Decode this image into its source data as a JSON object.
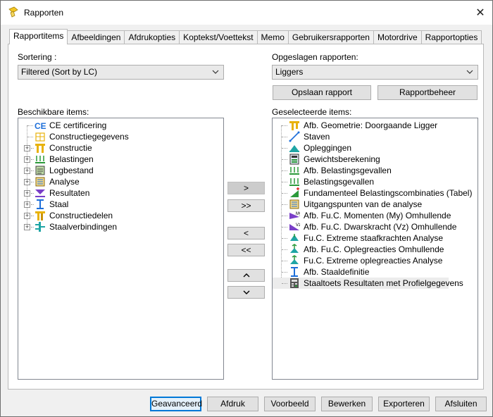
{
  "window": {
    "title": "Rapporten",
    "close_glyph": "✕"
  },
  "tabs": [
    {
      "label": "Rapportitems",
      "active": true
    },
    {
      "label": "Afbeeldingen"
    },
    {
      "label": "Afdrukopties"
    },
    {
      "label": "Koptekst/Voettekst"
    },
    {
      "label": "Memo"
    },
    {
      "label": "Gebruikersrapporten"
    },
    {
      "label": "Motordrive"
    },
    {
      "label": "Rapportopties"
    }
  ],
  "sort": {
    "label": "Sortering :",
    "value": "Filtered (Sort by LC)"
  },
  "saved": {
    "label": "Opgeslagen rapporten:",
    "value": "Liggers",
    "save_button": "Opslaan rapport",
    "manage_button": "Rapportbeheer"
  },
  "available": {
    "label": "Beschikbare items:",
    "items": [
      {
        "label": "CE certificering",
        "icon": "ce-icon",
        "expandable": false
      },
      {
        "label": "Constructiegegevens",
        "icon": "structure-data-icon",
        "expandable": false
      },
      {
        "label": "Constructie",
        "icon": "construction-icon",
        "expandable": true
      },
      {
        "label": "Belastingen",
        "icon": "loads-icon",
        "expandable": true
      },
      {
        "label": "Logbestand",
        "icon": "logfile-icon",
        "expandable": true
      },
      {
        "label": "Analyse",
        "icon": "analysis-icon",
        "expandable": true
      },
      {
        "label": "Resultaten",
        "icon": "results-icon",
        "expandable": true
      },
      {
        "label": "Staal",
        "icon": "steel-icon",
        "expandable": true
      },
      {
        "label": "Constructiedelen",
        "icon": "members-icon",
        "expandable": true
      },
      {
        "label": "Staalverbindingen",
        "icon": "steel-connection-icon",
        "expandable": true
      }
    ]
  },
  "selected": {
    "label": "Geselecteerde items:",
    "items": [
      {
        "label": "Afb. Geometrie: Doorgaande Ligger",
        "icon": "geometry-icon"
      },
      {
        "label": "Staven",
        "icon": "bars-icon"
      },
      {
        "label": "Opleggingen",
        "icon": "supports-icon"
      },
      {
        "label": "Gewichtsberekening",
        "icon": "weight-calc-icon"
      },
      {
        "label": "Afb. Belastingsgevallen",
        "icon": "loadcase-fig-icon"
      },
      {
        "label": "Belastingsgevallen",
        "icon": "loadcase-icon"
      },
      {
        "label": "Fundamenteel Belastingscombinaties (Tabel)",
        "icon": "load-combination-icon"
      },
      {
        "label": "Uitgangspunten van de analyse",
        "icon": "analysis-basis-icon"
      },
      {
        "label": "Afb. Fu.C. Momenten (My) Omhullende",
        "icon": "moment-icon"
      },
      {
        "label": "Afb. Fu.C. Dwarskracht (Vz) Omhullende",
        "icon": "shear-icon"
      },
      {
        "label": "Fu.C. Extreme staafkrachten Analyse",
        "icon": "member-forces-icon"
      },
      {
        "label": "Afb. Fu.C. Oplegreacties Omhullende",
        "icon": "reactions-fig-icon"
      },
      {
        "label": "Fu.C. Extreme oplegreacties Analyse",
        "icon": "reactions-icon"
      },
      {
        "label": "Afb. Staaldefinitie",
        "icon": "steel-definition-icon"
      },
      {
        "label": "Staaltoets Resultaten met Profielgegevens",
        "icon": "steel-check-icon"
      }
    ]
  },
  "transfer": {
    "add": ">",
    "add_all": ">>",
    "remove": "<",
    "remove_all": "<<",
    "up": "^",
    "down": "v"
  },
  "footer": {
    "advanced": "Geavanceerd",
    "print": "Afdruk",
    "preview": "Voorbeeld",
    "edit": "Bewerken",
    "export": "Exporteren",
    "close": "Afsluiten"
  },
  "colors": {
    "accent": "#0078d7",
    "icon_yellow": "#e8b20a",
    "icon_blue": "#1e6fd9",
    "icon_green": "#2b9a3a"
  }
}
